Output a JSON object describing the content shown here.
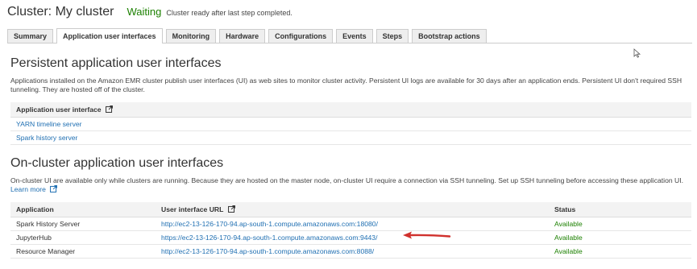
{
  "header": {
    "title": "Cluster: My cluster",
    "status": "Waiting",
    "status_message": "Cluster ready after last step completed."
  },
  "tabs": [
    {
      "label": "Summary",
      "active": false
    },
    {
      "label": "Application user interfaces",
      "active": true
    },
    {
      "label": "Monitoring",
      "active": false
    },
    {
      "label": "Hardware",
      "active": false
    },
    {
      "label": "Configurations",
      "active": false
    },
    {
      "label": "Events",
      "active": false
    },
    {
      "label": "Steps",
      "active": false
    },
    {
      "label": "Bootstrap actions",
      "active": false
    }
  ],
  "persistent": {
    "heading": "Persistent application user interfaces",
    "description": "Applications installed on the Amazon EMR cluster publish user interfaces (UI) as web sites to monitor cluster activity. Persistent UI logs are available for 30 days after an application ends. Persistent UI don't required SSH tunneling. They are hosted off of the cluster.",
    "column_header": "Application user interface",
    "items": [
      "YARN timeline server",
      "Spark history server"
    ]
  },
  "oncluster": {
    "heading": "On-cluster application user interfaces",
    "description": "On-cluster UI are available only while clusters are running. Because they are hosted on the master node, on-cluster UI require a connection via SSH tunneling. Set up SSH tunneling before accessing these application UI.",
    "learn_more": "Learn more",
    "columns": {
      "application": "Application",
      "url": "User interface URL",
      "status": "Status"
    },
    "rows": [
      {
        "application": "Spark History Server",
        "url": "http://ec2-13-126-170-94.ap-south-1.compute.amazonaws.com:18080/",
        "status": "Available"
      },
      {
        "application": "JupyterHub",
        "url": "https://ec2-13-126-170-94.ap-south-1.compute.amazonaws.com:9443/",
        "status": "Available"
      },
      {
        "application": "Resource Manager",
        "url": "http://ec2-13-126-170-94.ap-south-1.compute.amazonaws.com:8088/",
        "status": "Available"
      }
    ]
  },
  "colors": {
    "status_green": "#1d8102",
    "link_blue": "#1f6fb2",
    "arrow_red": "#d0312d"
  },
  "icons": {
    "external_link": "external-link-icon",
    "cursor": "mouse-pointer-icon",
    "annotation": "red-arrow"
  }
}
